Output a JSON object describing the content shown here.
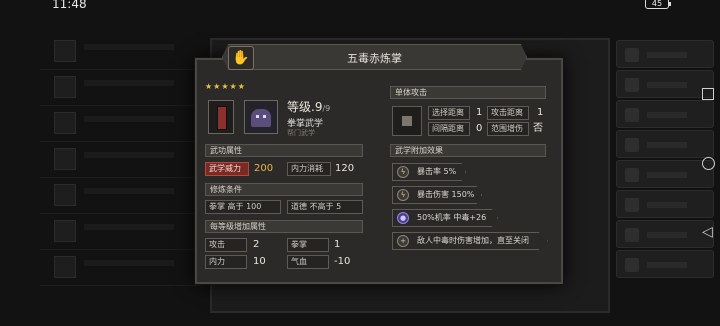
{
  "status_bar": {
    "time": "11:48",
    "battery": "45"
  },
  "modal": {
    "title": "五毒赤炼掌",
    "stars": "★★★★★",
    "level_label": "等级",
    "level_value": ".9",
    "level_max": "/9",
    "category": "拳掌武学",
    "sect": "帮门武学"
  },
  "attack": {
    "section_label": "单体攻击",
    "select_range_label": "选择距离",
    "select_range_value": "1",
    "attack_range_label": "攻击距离",
    "attack_range_value": "1",
    "interval_label": "间隔距离",
    "interval_value": "0",
    "aoe_label": "范围增伤",
    "aoe_value": "否"
  },
  "martial_stats": {
    "section_label": "武功属性",
    "power_label": "武学威力",
    "power_value": "200",
    "inner_cost_label": "内力消耗",
    "inner_cost_value": "120"
  },
  "requirements": {
    "section_label": "修炼条件",
    "req1_label": "拳掌 高于 100",
    "req2_label": "道德 不高于 5"
  },
  "level_bonus": {
    "section_label": "每等级增加属性",
    "attack_label": "攻击",
    "attack_value": "2",
    "fist_label": "拳掌",
    "fist_value": "1",
    "inner_label": "内力",
    "inner_value": "10",
    "qixue_label": "气血",
    "qixue_value": "-10"
  },
  "effects": {
    "section_label": "武学附加效果",
    "items": [
      {
        "icon": "lightning-icon",
        "text": "暴击率 5%"
      },
      {
        "icon": "lightning-icon",
        "text": "暴击伤害 150%"
      },
      {
        "icon": "poison-icon",
        "text": "50%机率 中毒+26"
      },
      {
        "icon": "plus-icon",
        "text": "敌人中毒时伤害增加，直至关闭"
      }
    ]
  }
}
